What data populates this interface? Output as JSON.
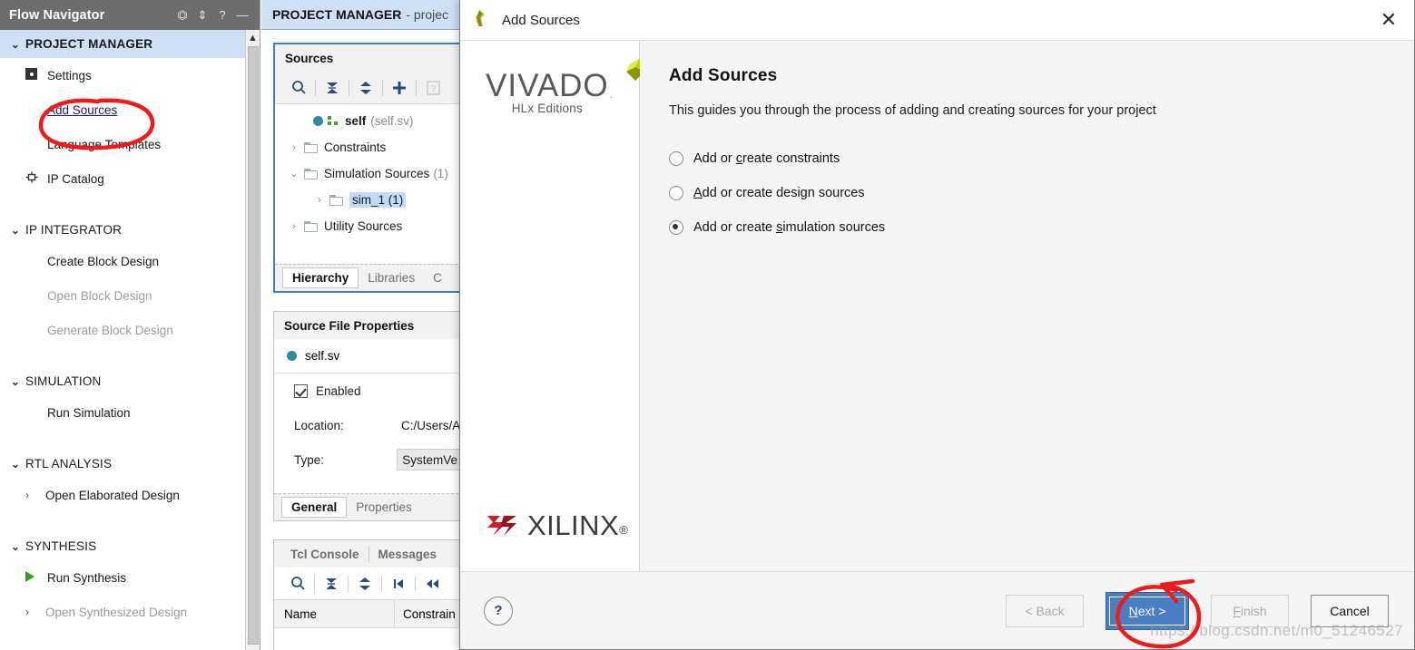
{
  "flow_navigator": {
    "title": "Flow Navigator",
    "header_icons": [
      "collapse-all-icon",
      "expand-collapse-icon",
      "help-icon",
      "minimize-icon"
    ],
    "sections": [
      {
        "label": "PROJECT MANAGER",
        "active": true,
        "items": [
          {
            "label": "Settings",
            "icon": "gear-icon",
            "state": "normal"
          },
          {
            "label": "Add Sources",
            "icon": "none",
            "state": "link"
          },
          {
            "label": "Language Templates",
            "icon": "none",
            "state": "normal"
          },
          {
            "label": "IP Catalog",
            "icon": "ip-catalog-icon",
            "state": "normal"
          }
        ]
      },
      {
        "label": "IP INTEGRATOR",
        "active": false,
        "items": [
          {
            "label": "Create Block Design",
            "icon": "none",
            "state": "normal"
          },
          {
            "label": "Open Block Design",
            "icon": "none",
            "state": "disabled"
          },
          {
            "label": "Generate Block Design",
            "icon": "none",
            "state": "disabled"
          }
        ]
      },
      {
        "label": "SIMULATION",
        "active": false,
        "items": [
          {
            "label": "Run Simulation",
            "icon": "none",
            "state": "normal"
          }
        ]
      },
      {
        "label": "RTL ANALYSIS",
        "active": false,
        "items": [
          {
            "label": "Open Elaborated Design",
            "icon": "chevron-right-icon",
            "state": "normal"
          }
        ]
      },
      {
        "label": "SYNTHESIS",
        "active": false,
        "items": [
          {
            "label": "Run Synthesis",
            "icon": "play-icon",
            "state": "normal"
          },
          {
            "label": "Open Synthesized Design",
            "icon": "chevron-right-icon",
            "state": "disabled"
          }
        ]
      }
    ]
  },
  "project_header": {
    "title": "PROJECT MANAGER",
    "subtitle": "- projec"
  },
  "sources_panel": {
    "title": "Sources",
    "toolbar": [
      "search-icon",
      "collapse-all-icon",
      "expand-all-icon",
      "add-sources-icon",
      "help-icon"
    ],
    "tree": [
      {
        "label": "self",
        "suffix": "(self.sv)",
        "icon": "blue-dot-icon",
        "twisty": "",
        "indent": 2,
        "bold": true
      },
      {
        "label": "Constraints",
        "suffix": "",
        "icon": "folder-icon",
        "twisty": "›",
        "indent": 0,
        "bold": false
      },
      {
        "label": "Simulation Sources",
        "suffix": "(1)",
        "icon": "folder-icon",
        "twisty": "⌄",
        "indent": 0,
        "bold": false
      },
      {
        "label": "sim_1 (1)",
        "suffix": "",
        "icon": "folder-icon",
        "twisty": "›",
        "indent": 1,
        "bold": false,
        "selected": true
      },
      {
        "label": "Utility Sources",
        "suffix": "",
        "icon": "folder-icon",
        "twisty": "›",
        "indent": 0,
        "bold": false
      }
    ],
    "tabs": [
      {
        "label": "Hierarchy",
        "active": true
      },
      {
        "label": "Libraries",
        "active": false
      },
      {
        "label": "C",
        "active": false
      }
    ]
  },
  "source_properties_panel": {
    "title": "Source File Properties",
    "file_name": "self.sv",
    "enabled_label": "Enabled",
    "enabled_checked": true,
    "location_label": "Location:",
    "location_value": "C:/Users/A",
    "type_label": "Type:",
    "type_value": "SystemVe",
    "tabs": [
      {
        "label": "General",
        "active": true
      },
      {
        "label": "Properties",
        "active": false
      }
    ]
  },
  "console_panel": {
    "tabs": [
      {
        "label": "Tcl Console",
        "active": false
      },
      {
        "label": "Messages",
        "active": false
      }
    ],
    "toolbar": [
      "search-icon",
      "collapse-all-icon",
      "expand-all-icon",
      "first-icon",
      "previous-icon"
    ],
    "columns": [
      "Name",
      "Constrain"
    ]
  },
  "dialog": {
    "window_title": "Add Sources",
    "close_icon": "close-icon",
    "logo": {
      "vivado_word": "VIVADO",
      "vivado_sub": "HLx Editions",
      "xilinx_word": "XILINX",
      "xilinx_registered": "®"
    },
    "heading": "Add Sources",
    "description": "This guides you through the process of adding and creating sources for your project",
    "options": [
      {
        "label_pre": "Add or ",
        "mnemonic": "c",
        "label_post": "reate constraints",
        "checked": false,
        "name": "add-or-create-constraints"
      },
      {
        "label_pre": "",
        "mnemonic": "A",
        "label_post": "dd or create design sources",
        "checked": false,
        "name": "add-or-create-design-sources"
      },
      {
        "label_pre": "Add or create ",
        "mnemonic": "s",
        "label_post": "imulation sources",
        "checked": true,
        "name": "add-or-create-simulation-sources"
      }
    ],
    "footer": {
      "help_label": "?",
      "back_label": "< Back",
      "next_label": "Next >",
      "finish_label": "Finish",
      "cancel_label": "Cancel",
      "back_disabled": true,
      "finish_disabled": true,
      "next_focused": true
    }
  },
  "watermark": "https://blog.csdn.net/m0_51246527",
  "colors": {
    "accent_blue": "#4a7ec4",
    "section_highlight": "#cfe0f5",
    "annotation_red": "#ee1b1b",
    "link_blue": "#1a1a6e",
    "titlebar_gray": "#6d6d6d"
  }
}
